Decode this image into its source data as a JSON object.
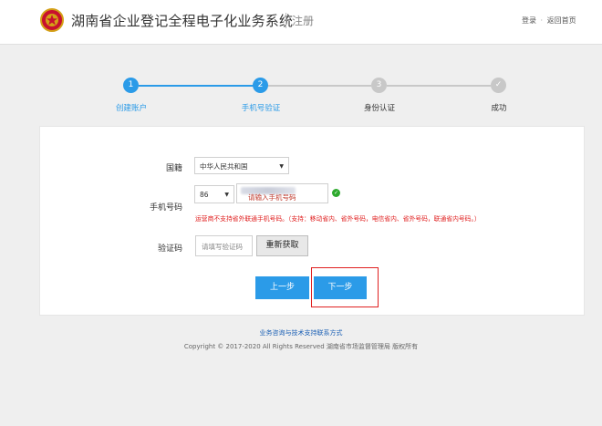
{
  "header": {
    "title": "湖南省企业登记全程电子化业务系统",
    "subtitle": "注册",
    "links": {
      "login": "登录",
      "separator": "·",
      "home": "返回首页"
    }
  },
  "steps": [
    {
      "num": "1",
      "label": "创建账户",
      "state": "done"
    },
    {
      "num": "2",
      "label": "手机号验证",
      "state": "current"
    },
    {
      "num": "3",
      "label": "身份认证",
      "state": "todo"
    },
    {
      "num": "✓",
      "label": "成功",
      "state": "todo"
    }
  ],
  "form": {
    "nationality_label": "国籍",
    "nationality_value": "中华人民共和国",
    "phone_label": "手机号码",
    "country_code": "86",
    "phone_placeholder": "请输入手机号码",
    "operator_warning": "运营商不支持省外联通手机号码。（支持：移动省内、省外号码，电信省内、省外号码，联通省内号码。）",
    "code_label": "验证码",
    "code_placeholder": "请填写验证码",
    "refresh_button": "重新获取",
    "prev_button": "上一步",
    "next_button": "下一步"
  },
  "footer": {
    "support_link": "业务咨询与技术支持联系方式",
    "copyright": "Copyright © 2017-2020 All Rights Reserved 湖南省市场监督管理局 版权所有"
  },
  "colors": {
    "accent": "#2b9be8",
    "step_done": "#2b9be8",
    "step_todo": "#c8c8c8",
    "warning": "#e02020",
    "success": "#2eaa2e"
  },
  "icons": {
    "emblem": "national-emblem-icon",
    "check": "check-circle-icon",
    "dropdown": "caret-down-icon"
  }
}
